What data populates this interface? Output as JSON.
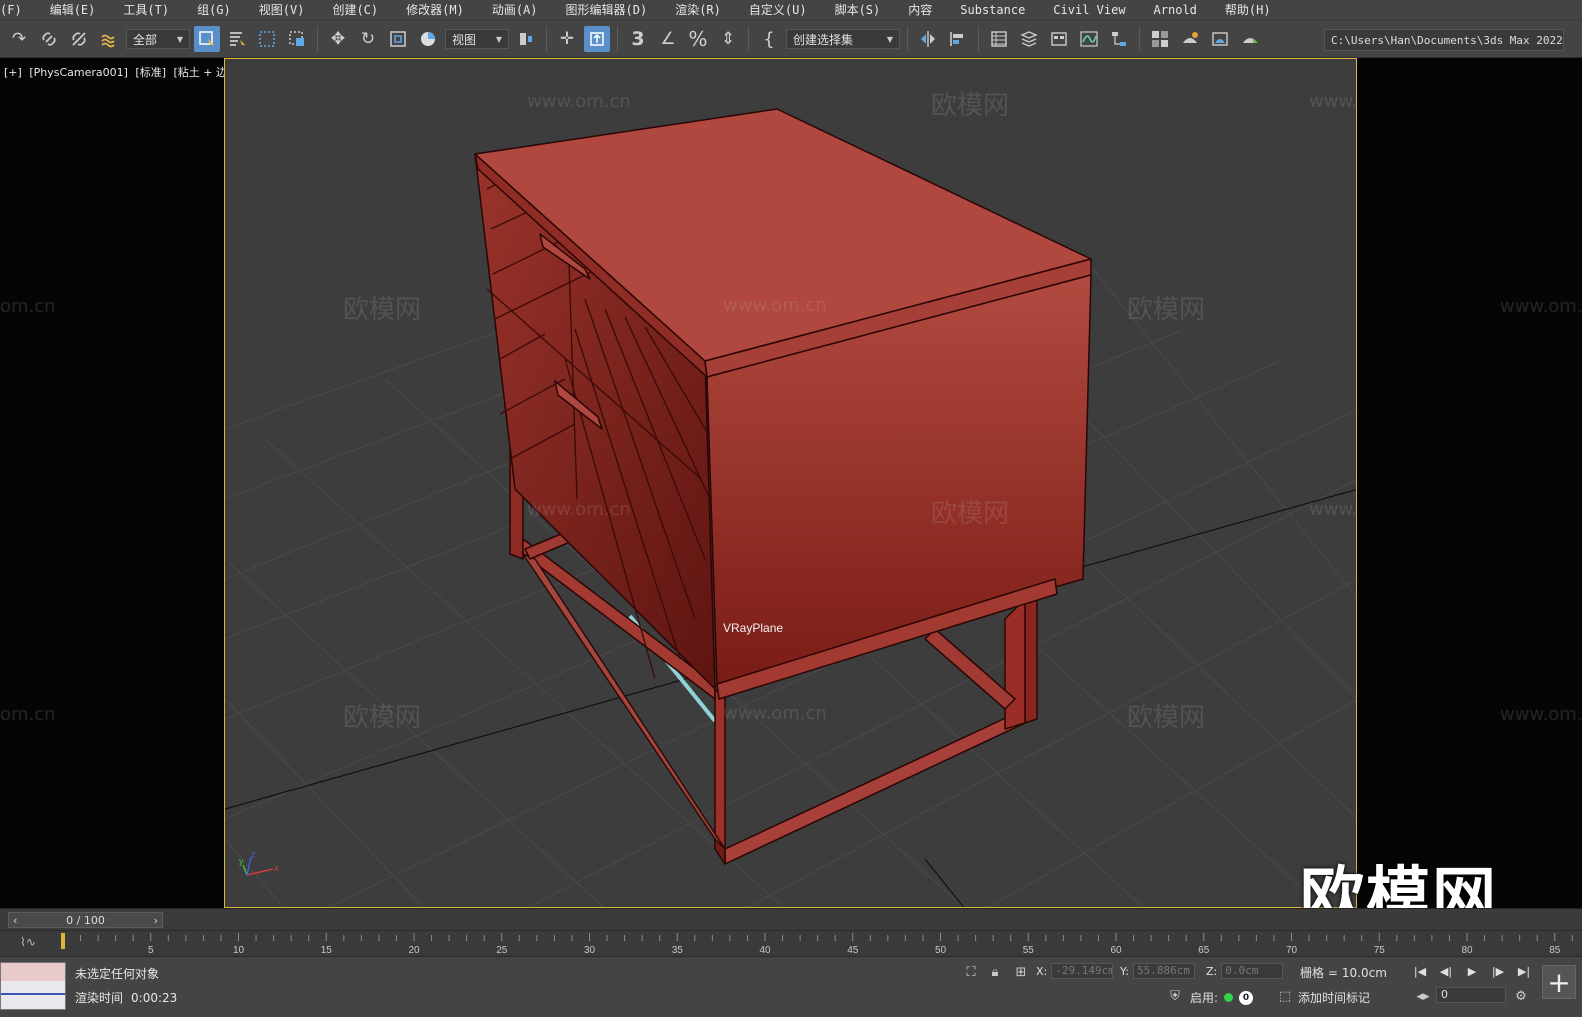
{
  "menu": {
    "items": [
      "(F)",
      "编辑(E)",
      "工具(T)",
      "组(G)",
      "视图(V)",
      "创建(C)",
      "修改器(M)",
      "动画(A)",
      "图形编辑器(D)",
      "渲染(R)",
      "自定义(U)",
      "脚本(S)",
      "内容",
      "Substance",
      "Civil View",
      "Arnold",
      "帮助(H)"
    ]
  },
  "toolbar": {
    "filter_dropdown": "全部",
    "ref_coord_dropdown": "视图",
    "selection_set_dropdown": "创建选择集",
    "project_path": "C:\\Users\\Han\\Documents\\3ds Max 2022"
  },
  "viewport": {
    "label_plus": "[+]",
    "label_camera": "[PhysCamera001]",
    "label_shading": "[标准]",
    "label_mode": "[粘土 + 边面]",
    "object_label": "VRayPlane",
    "brand_mark": "欧模网",
    "watermark_text": "欧模网",
    "watermark_site": "www.om.cn",
    "watermark_site_partial": "om.cn",
    "axis_x": "x",
    "axis_y": "y",
    "axis_z": "z"
  },
  "timeline": {
    "frame_display": "0 / 100",
    "current_frame": 0,
    "total_frames": 100,
    "ticks": [
      5,
      10,
      15,
      20,
      25,
      30,
      35,
      40,
      45,
      50,
      55,
      60,
      65,
      70,
      75,
      80,
      85
    ]
  },
  "status": {
    "selection_text": "未选定任何对象",
    "render_time_label": "渲染时间",
    "render_time_value": "0:00:23",
    "x_label": "X:",
    "x_value": "-29.149cm",
    "y_label": "Y:",
    "y_value": "55.886cm",
    "z_label": "Z:",
    "z_value": "0.0cm",
    "grid_label": "栅格 =",
    "grid_value": "10.0cm",
    "enable_label": "启用:",
    "enable_count": "0",
    "add_time_tag": "添加时间标记",
    "frame_field": "0"
  },
  "colors": {
    "accent": "#5b8fc9",
    "viewport_border": "#d9b93a",
    "object": "#a8433c",
    "enabled_dot": "#35d24a"
  }
}
